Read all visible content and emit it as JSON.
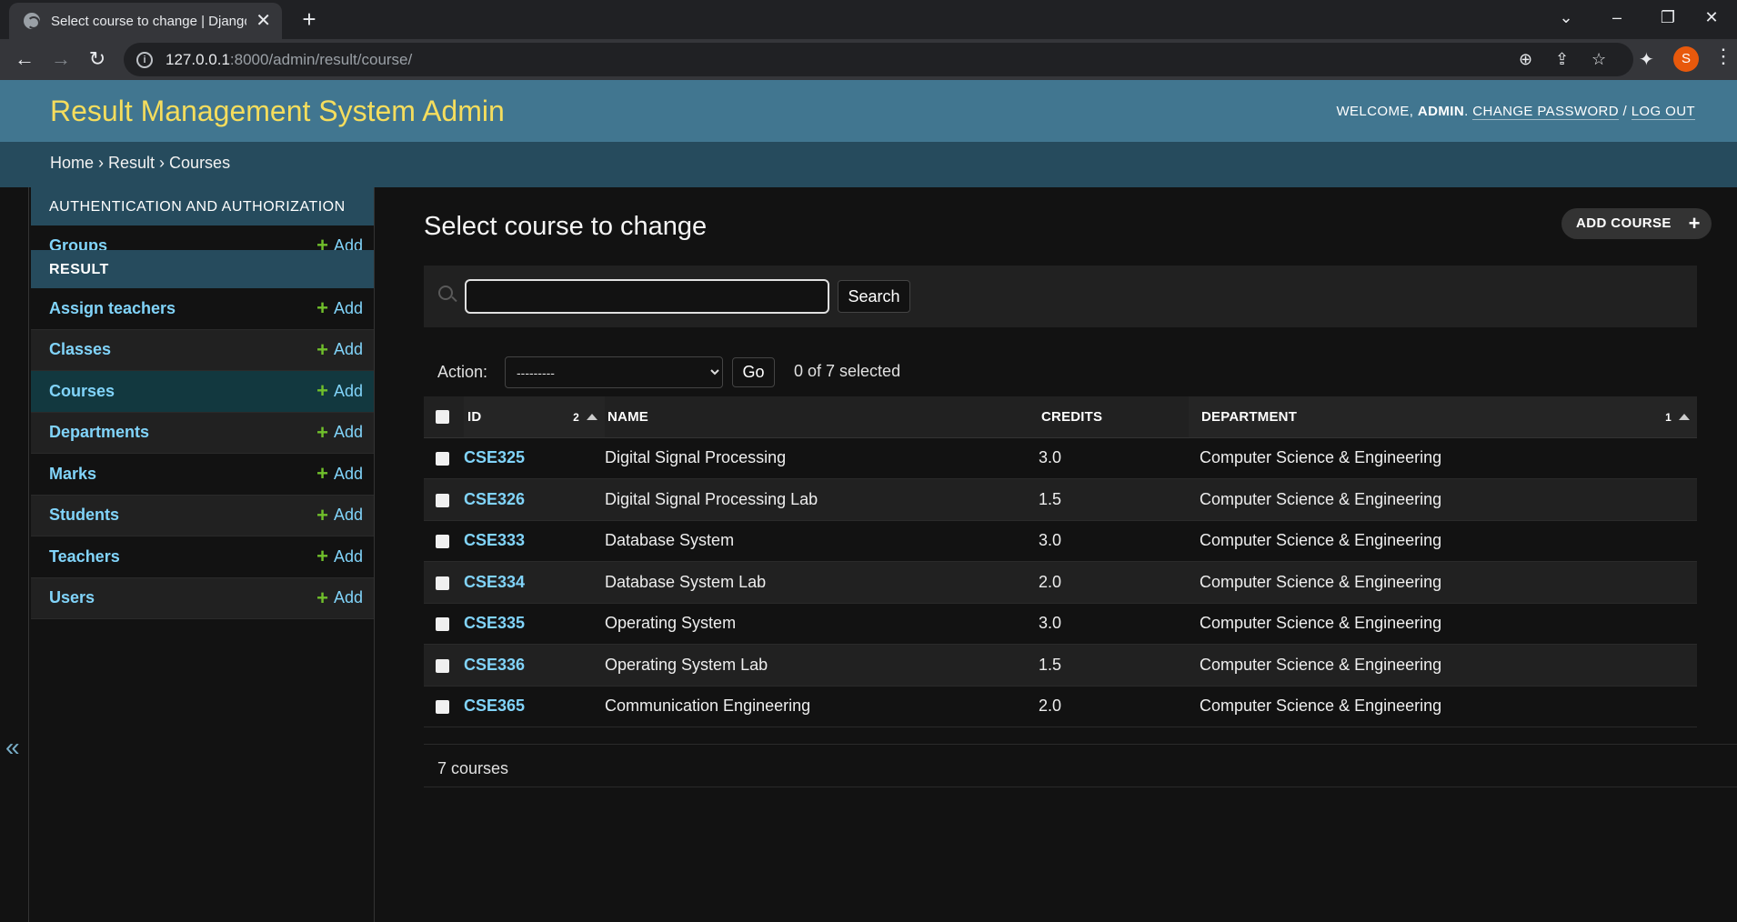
{
  "browser": {
    "tab_title": "Select course to change | Django",
    "url_host": "127.0.0.1",
    "url_path": ":8000/admin/result/course/",
    "profile_initial": "S"
  },
  "header": {
    "branding": "Result Management System Admin",
    "welcome": "WELCOME, ",
    "username": "ADMIN",
    "sep1": ". ",
    "change_password": "CHANGE PASSWORD",
    "sep2": " / ",
    "logout": "LOG OUT"
  },
  "breadcrumbs": {
    "home": "Home",
    "app": "Result",
    "current": "Courses",
    "separator": " › "
  },
  "sidebar": {
    "collapse_glyph": "«",
    "auth": {
      "caption": "AUTHENTICATION AND AUTHORIZATION",
      "items": [
        {
          "name": "Groups",
          "add": "Add"
        }
      ]
    },
    "result": {
      "caption": "RESULT",
      "items": [
        {
          "name": "Assign teachers",
          "add": "Add"
        },
        {
          "name": "Classes",
          "add": "Add"
        },
        {
          "name": "Courses",
          "add": "Add"
        },
        {
          "name": "Departments",
          "add": "Add"
        },
        {
          "name": "Marks",
          "add": "Add"
        },
        {
          "name": "Students",
          "add": "Add"
        },
        {
          "name": "Teachers",
          "add": "Add"
        },
        {
          "name": "Users",
          "add": "Add"
        }
      ]
    }
  },
  "main": {
    "title": "Select course to change",
    "add_button": "ADD COURSE",
    "search_value": "",
    "search_button": "Search",
    "action_label": "Action:",
    "action_selected": "---------",
    "go_button": "Go",
    "selection_counter": "0 of 7 selected",
    "columns": {
      "id": "ID",
      "id_sort": "2",
      "name": "NAME",
      "credits": "CREDITS",
      "department": "DEPARTMENT",
      "department_sort": "1"
    },
    "rows": [
      {
        "id": "CSE325",
        "name": "Digital Signal Processing",
        "credits": "3.0",
        "department": "Computer Science & Engineering"
      },
      {
        "id": "CSE326",
        "name": "Digital Signal Processing Lab",
        "credits": "1.5",
        "department": "Computer Science & Engineering"
      },
      {
        "id": "CSE333",
        "name": "Database System",
        "credits": "3.0",
        "department": "Computer Science & Engineering"
      },
      {
        "id": "CSE334",
        "name": "Database System Lab",
        "credits": "2.0",
        "department": "Computer Science & Engineering"
      },
      {
        "id": "CSE335",
        "name": "Operating System",
        "credits": "3.0",
        "department": "Computer Science & Engineering"
      },
      {
        "id": "CSE336",
        "name": "Operating System Lab",
        "credits": "1.5",
        "department": "Computer Science & Engineering"
      },
      {
        "id": "CSE365",
        "name": "Communication Engineering",
        "credits": "2.0",
        "department": "Computer Science & Engineering"
      }
    ],
    "paginator": "7 courses"
  },
  "colors": {
    "header_bg": "#417690",
    "branding": "#f5dd5d",
    "breadcrumb_bg": "#264b5d",
    "link": "#81d4fa",
    "add_plus": "#70bf2b",
    "selected_row": "#12383f"
  }
}
